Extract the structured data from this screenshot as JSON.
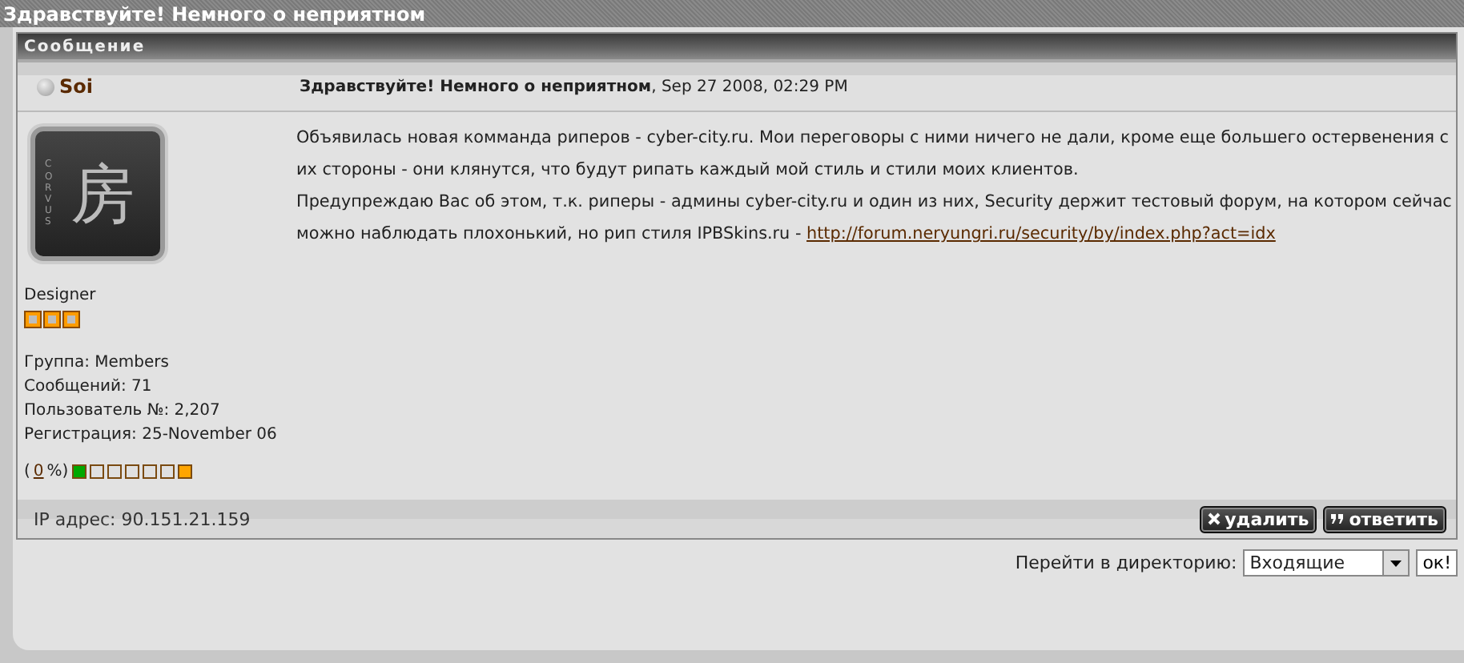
{
  "page_title": "Здравствуйте! Немного о неприятном",
  "section_title": "Сообщение",
  "post": {
    "author": "Soi",
    "online": false,
    "subject": "Здравствуйте! Немного о неприятном",
    "date": ", Sep 27 2008, 02:29 PM",
    "avatar": {
      "side_text": "CORVUS",
      "glyph": "房"
    },
    "rank": {
      "title": "Designer",
      "stars": 3
    },
    "info": [
      "Группа: Members",
      "Сообщений: 71",
      "Пользователь №: 2,207",
      "Регистрация: 25-November 06"
    ],
    "warn": {
      "open": "(",
      "value": "0",
      "close": "%)",
      "squares": [
        {
          "color": "#00a800"
        },
        {
          "color": "#e0e0e0"
        },
        {
          "color": "#e0e0e0"
        },
        {
          "color": "#e0e0e0"
        },
        {
          "color": "#e0e0e0"
        },
        {
          "color": "#e0e0e0"
        },
        {
          "color": "#ffa500"
        }
      ]
    },
    "body": [
      {
        "text": "Объявилась новая комманда риперов - cyber-city.ru. Мои переговоры с ними ничего не дали, кроме еще большего остервенения с их стороны - они клянутся, что будут рипать каждый мой стиль и стили моих клиентов."
      },
      {
        "text": "Предупреждаю Вас об этом, т.к. риперы - админы cyber-city.ru и один из них, Security держит тестовый форум, на котором сейчас можно наблюдать плохонький, но рип стиля IPBSkins.ru - ",
        "link": "http://forum.neryungri.ru/security/by/index.php?act=idx"
      }
    ],
    "ip": "IP адрес: 90.151.21.159",
    "buttons": [
      {
        "kind": "delete",
        "label": "удалить"
      },
      {
        "kind": "reply",
        "label": "ответить"
      }
    ]
  },
  "jump": {
    "label": "Перейти в директорию:",
    "value": "Входящие",
    "button": "ок!"
  }
}
